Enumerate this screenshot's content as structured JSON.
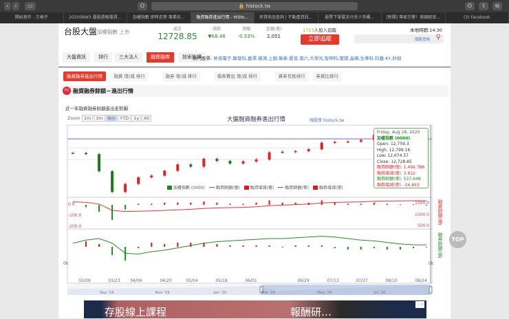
{
  "browser": {
    "url": "histock.tw",
    "tabs": [
      "開始寫作 - 方格子",
      "202008W3 臺股週報電週...",
      "加權指數 即時走勢 專業技...",
      "融資融券進出行情 - HiSto...",
      "房貸商品查詢 | 不動產資訊...",
      "股票下單要支付多少手續...",
      "[新聞] 專家示警！美國經濟...",
      "(3) Facebook"
    ],
    "active_tab": 3
  },
  "header": {
    "title": "台股大盤",
    "subtitle": "加權指數 上市",
    "stats": [
      {
        "label": "成交",
        "value": "12728.85"
      },
      {
        "label": "漲跌",
        "value": "▼68.46"
      },
      {
        "label": "漲幅",
        "value": "-0.53%"
      },
      {
        "label": "金額(億)",
        "value": "2,051"
      }
    ],
    "followers_count": "1713",
    "followers_text": "人加入追蹤",
    "follow_button": "立即追蹤",
    "local_time": "本地時間:14:30",
    "search_placeholder": "個股查詢"
  },
  "nav": {
    "items": [
      "大盤資訊",
      "排行",
      "三大法人",
      "融資融券",
      "技術指標"
    ],
    "active": 3,
    "hot_label": "熱門股票:",
    "hot_stocks": "昇佳電子,聯發科,嘉澤,億鴻,上銀,聯泰,愛普,南六,大學光,智伸科,聚陽,晶碩,生華科,科嘉-KY,矽創"
  },
  "subtabs": {
    "items": [
      "融資融券進出行情",
      "融資 增/減 排行",
      "融券 增/減 排行",
      "借券賣出 增/減 排行",
      "資券互抵排行",
      "券資比排行"
    ],
    "active": 0
  },
  "section": {
    "title": "融資融券餘額－進出行情",
    "desc": "近一年融資融券餘額進出走勢圖"
  },
  "chart_data": {
    "type": "line",
    "title": "大盤融資融券進出行情",
    "credit": "嗨投資 histock.tw",
    "zoom_label": "Zoom",
    "zoom_buttons": [
      "1m",
      "3m",
      "6m",
      "YTD",
      "1y",
      "All"
    ],
    "zoom_active": "6m",
    "legend": [
      "加權指數 (0000)",
      "融資餘額(億)",
      "融資增減(億)",
      "融券餘額(張)",
      "融券增減(張)"
    ],
    "x_ticks": [
      "03/09",
      "03/23",
      "04/06",
      "04/20",
      "05/04",
      "05/18",
      "06/01",
      "06/29",
      "07/13",
      "07/27",
      "08/10",
      "08/24"
    ],
    "navigator_ticks": [
      "Sep '19",
      "Nov '19",
      "Jan '20",
      "Mar '20",
      "May '20",
      "Jul '20"
    ],
    "index_close": [
      11400,
      11321,
      10128,
      8681,
      9234,
      9698,
      9818,
      10157,
      10597,
      10447,
      10992,
      10842,
      10663,
      10811,
      10942,
      11442,
      11480,
      11527,
      11660,
      12116,
      12170,
      12196,
      12305,
      12664,
      12795,
      12795,
      12875,
      12728
    ],
    "margin_balance": [
      1460,
      1440,
      1380,
      1150,
      1110,
      1120,
      1130,
      1150,
      1170,
      1190,
      1220,
      1240,
      1250,
      1260,
      1280,
      1320,
      1340,
      1360,
      1380,
      1420,
      1440,
      1450,
      1460,
      1480,
      1490,
      1495,
      1500,
      1497
    ],
    "short_balance": [
      560,
      600,
      620,
      560,
      430,
      420,
      450,
      470,
      500,
      530,
      560,
      580,
      590,
      600,
      610,
      620,
      620,
      630,
      640,
      650,
      640,
      620,
      600,
      590,
      570,
      550,
      540,
      538
    ],
    "margin_axis": {
      "labels_left": [
        "0.0",
        "-100.0",
        "-200.0"
      ],
      "labels_right": [
        "1500.0",
        "1000.0",
        "500.0"
      ],
      "title_right": "融資餘額(億)"
    },
    "short_axis": {
      "labels_left": [
        "0k"
      ],
      "labels_right": [
        "0k"
      ],
      "title_right": "融券餘額(張)"
    }
  },
  "tooltip": {
    "date": "Friday, Aug 28, 2020",
    "series": "加權指數 (0000)",
    "open": "Open: 12,759.3",
    "high": "High: 12,799.16",
    "low": "Low: 12,674.57",
    "close": "Close: 12,728.85",
    "margin_bal": "融資餘額(億): 1,496.786",
    "margin_chg": "融資增減(億): 3.812",
    "short_bal": "融券餘額(張): 537,648",
    "short_chg": "融券增減(張): -16,663"
  },
  "top_button": "TOP",
  "ad": {
    "left": "存股線上課程",
    "right": "報酬研…"
  }
}
